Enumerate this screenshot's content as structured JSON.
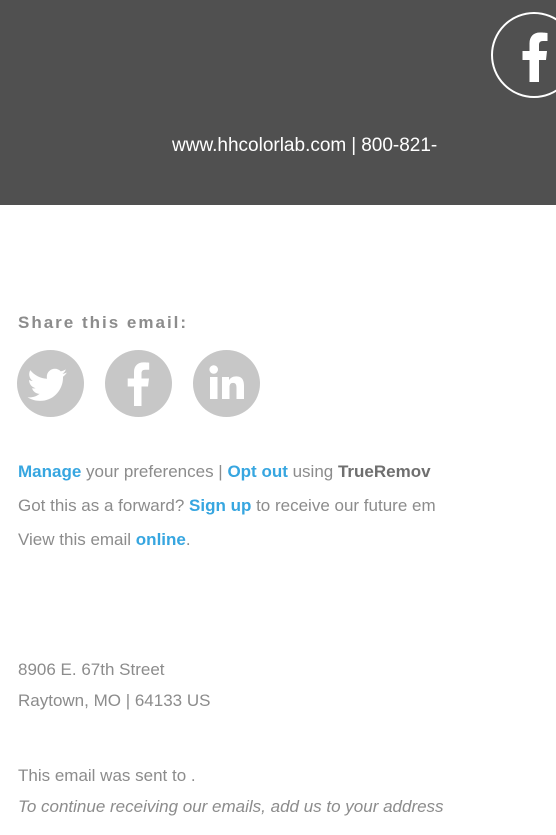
{
  "header": {
    "website": "www.hhcolorlab.com",
    "separator": "|",
    "phone": "800-821-",
    "facebook_icon": "facebook-icon",
    "background_color": "#505050"
  },
  "share": {
    "label": "Share this email:",
    "icons": [
      "twitter-icon",
      "facebook-icon",
      "linkedin-icon"
    ],
    "icon_color": "#c7c7c7"
  },
  "links": {
    "line1": {
      "manage": "Manage",
      "text1": " your preferences | ",
      "opt_out": "Opt out",
      "text2": " using ",
      "trueremove": "TrueRemov"
    },
    "line2": {
      "text1": "Got this as a forward? ",
      "sign_up": "Sign up",
      "text2": " to receive our future em"
    },
    "line3": {
      "text1": "View this email ",
      "online": "online",
      "text2": "."
    },
    "link_color": "#37a6e0"
  },
  "address": {
    "street": "8906 E. 67th Street",
    "city": "Raytown, MO | 64133 US"
  },
  "footer": {
    "sent_to": "This email was sent to .",
    "continue": "To continue receiving our emails, add us to your address"
  }
}
